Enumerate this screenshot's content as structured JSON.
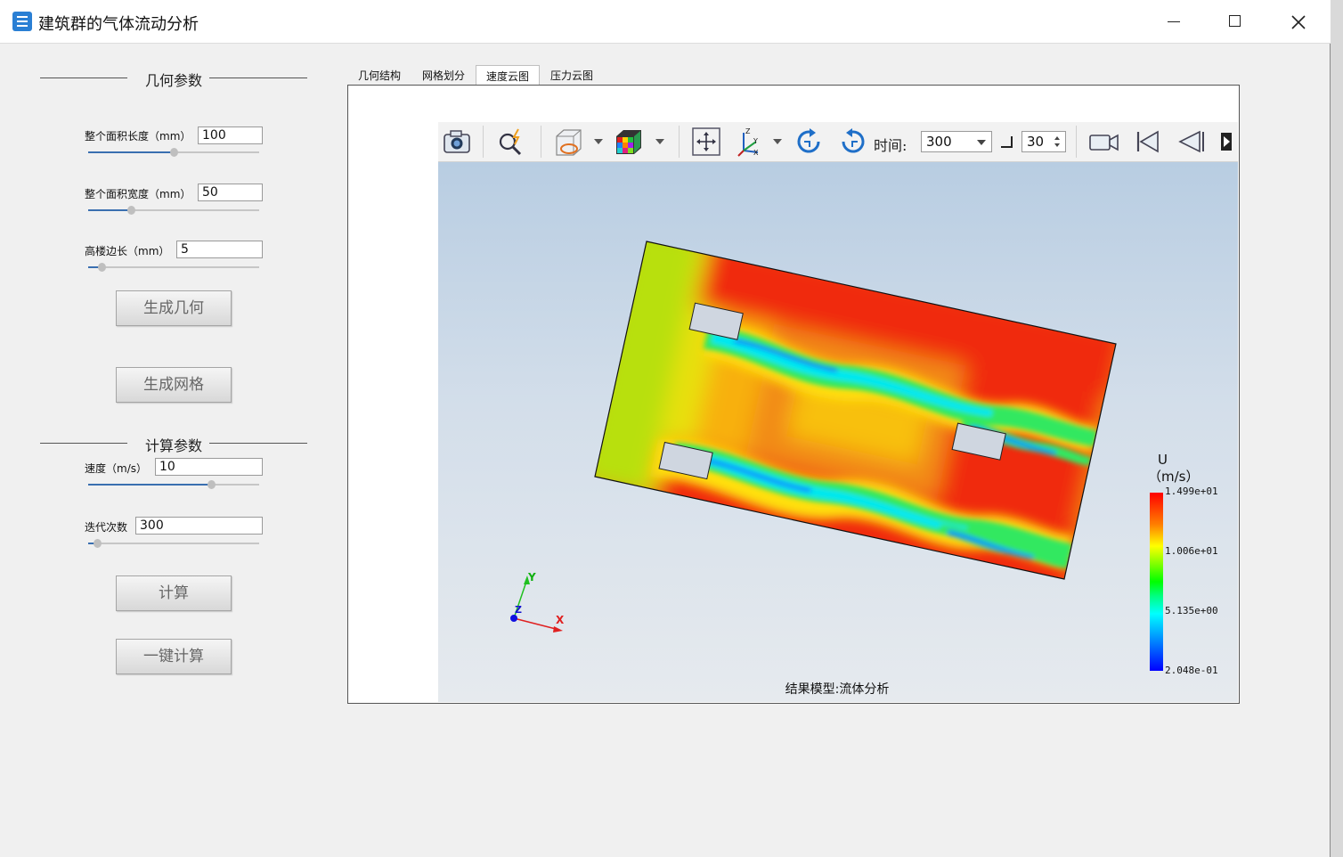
{
  "window": {
    "title": "建筑群的气体流动分析"
  },
  "sections": {
    "geometry": "几何参数",
    "compute": "计算参数"
  },
  "params": {
    "length": {
      "label": "整个面积长度（mm）",
      "value": "100",
      "fraction": 0.5
    },
    "width": {
      "label": "整个面积宽度（mm）",
      "value": "50",
      "fraction": 0.25
    },
    "building": {
      "label": "高楼边长（mm）",
      "value": "5",
      "fraction": 0.08
    },
    "speed": {
      "label": "速度（m/s）",
      "value": "10",
      "fraction": 0.72
    },
    "iterations": {
      "label": "迭代次数",
      "value": "300",
      "fraction": 0.05
    }
  },
  "buttons": {
    "gen_geometry": "生成几何",
    "gen_mesh": "生成网格",
    "compute": "计算",
    "one_click": "一键计算"
  },
  "tabs": [
    {
      "label": "几何结构",
      "active": false
    },
    {
      "label": "网格划分",
      "active": false
    },
    {
      "label": "速度云图",
      "active": true
    },
    {
      "label": "压力云图",
      "active": false
    }
  ],
  "toolbar": {
    "time_label": "时间:",
    "time_value": "300",
    "step_value": "30"
  },
  "legend": {
    "title": "U",
    "unit": "（m/s）",
    "ticks": [
      "1.499e+01",
      "1.006e+01",
      "5.135e+00",
      "2.048e-01"
    ]
  },
  "axes": {
    "x": "X",
    "y": "Y",
    "z": "Z"
  },
  "caption": "结果模型:流体分析",
  "colors": {
    "accent": "#3a6fb0",
    "icon_blue": "#2a7fd4"
  }
}
